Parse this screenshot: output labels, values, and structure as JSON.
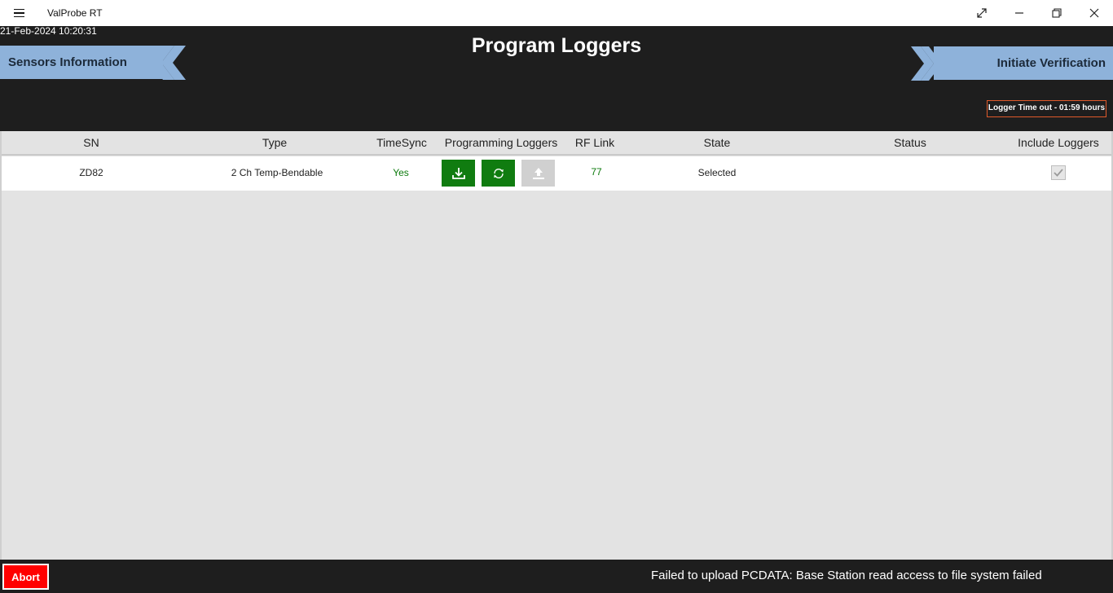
{
  "window": {
    "app_title": "ValProbe RT",
    "menu_icon": "hamburger-icon",
    "controls": [
      "expand-icon",
      "minimize-icon",
      "restore-icon",
      "close-icon"
    ]
  },
  "header": {
    "datetime": "21-Feb-2024 10:20:31",
    "page_title": "Program Loggers",
    "nav_back_label": "Sensors Information",
    "nav_forward_label": "Initiate Verification",
    "timeout_label": "Logger Time out - 01:59 hours"
  },
  "table": {
    "columns": [
      "SN",
      "Type",
      "TimeSync",
      "Programming Loggers",
      "RF Link",
      "State",
      "Status",
      "Include Loggers"
    ],
    "rows": [
      {
        "sn": "ZD82",
        "type": "2 Ch Temp-Bendable",
        "timesync": "Yes",
        "actions": [
          "download-icon",
          "sync-icon",
          "upload-icon"
        ],
        "rf_link": "77",
        "state": "Selected",
        "status": "",
        "include": true
      }
    ]
  },
  "footer": {
    "abort_label": "Abort",
    "message": "Failed to upload PCDATA:  Base Station read access to file system failed"
  },
  "colors": {
    "accent_nav": "#8eb2da",
    "success_green": "#107c10",
    "abort_red": "#ff0000",
    "timeout_border": "#e05a2b",
    "background_dark": "#1e1e1e"
  }
}
